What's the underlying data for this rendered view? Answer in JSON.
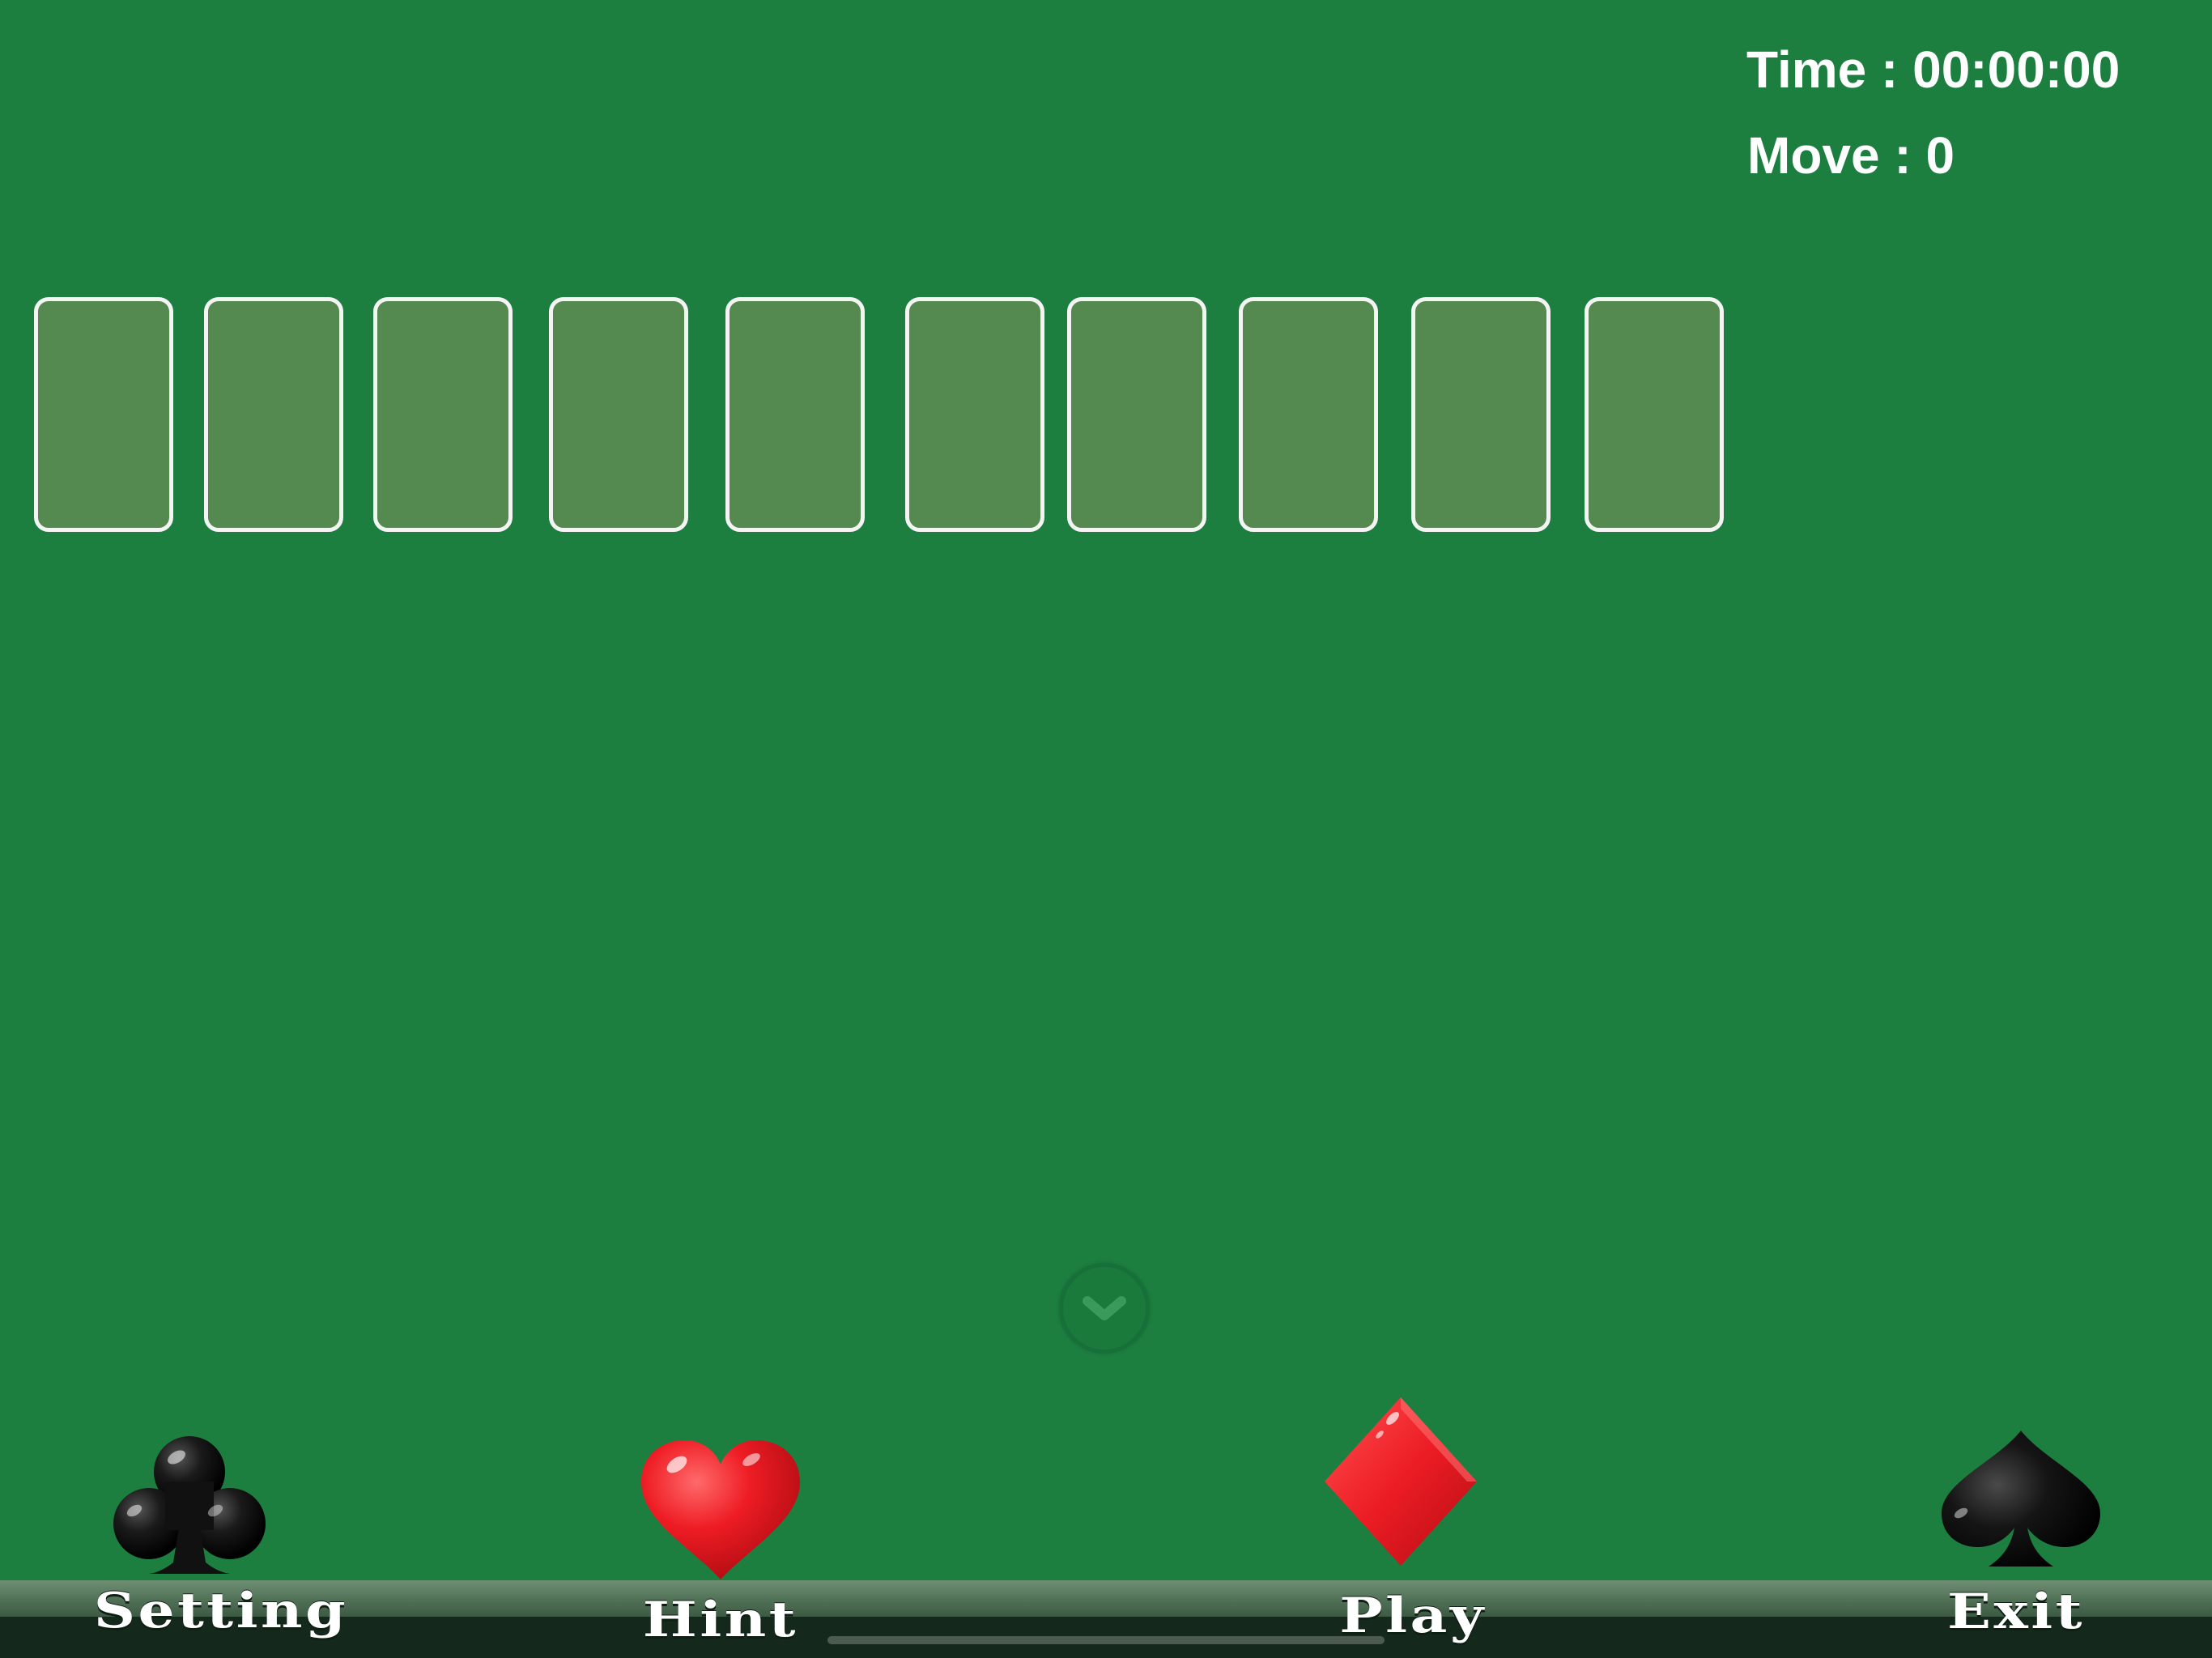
{
  "stats": {
    "time_label": "Time",
    "time_value": "00:00:00",
    "move_label": "Move",
    "move_value": "0",
    "separator": " : "
  },
  "tableau": {
    "empty_slot_count": 10
  },
  "toolbar": {
    "setting_label": "Setting",
    "hint_label": "Hint",
    "play_label": "Play",
    "exit_label": "Exit"
  },
  "colors": {
    "felt": "#1c7f40",
    "slot_fill": "#548a50",
    "slot_border": "#f4f4f4",
    "heart": "#e8262c",
    "diamond": "#e8262c",
    "club": "#111111",
    "spade": "#111111",
    "text": "#ffffff"
  },
  "icons": {
    "setting": "club-icon",
    "hint": "heart-icon",
    "play": "diamond-icon",
    "exit": "spade-icon",
    "collapse": "chevron-down-icon"
  }
}
